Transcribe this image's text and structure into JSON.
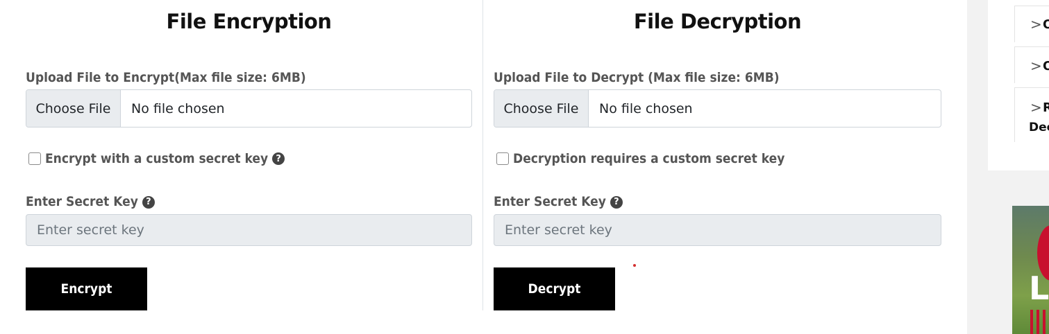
{
  "encrypt": {
    "title": "File Encryption",
    "upload_label": "Upload File to Encrypt(Max file size: 6MB)",
    "choose_file_label": "Choose File",
    "file_status": "No file chosen",
    "custom_key_checkbox_label": "Encrypt with a custom secret key",
    "custom_key_checked": false,
    "secret_key_label": "Enter Secret Key",
    "secret_key_value": "",
    "secret_key_placeholder": "Enter secret key",
    "action_label": "Encrypt"
  },
  "decrypt": {
    "title": "File Decryption",
    "upload_label": "Upload File to Decrypt (Max file size: 6MB)",
    "choose_file_label": "Choose File",
    "file_status": "No file chosen",
    "custom_key_checkbox_label": "Decryption requires a custom secret key",
    "custom_key_checked": false,
    "secret_key_label": "Enter Secret Key",
    "secret_key_value": "",
    "secret_key_placeholder": "Enter secret key",
    "action_label": "Decrypt"
  },
  "help_glyph": "?",
  "sidebar": {
    "items": [
      {
        "chevron": ">",
        "text": "O"
      },
      {
        "chevron": ">",
        "text": "O"
      },
      {
        "chevron": ">",
        "text": "R",
        "text2": "Dec"
      }
    ]
  },
  "ad": {
    "letter": "L"
  },
  "colors": {
    "button_bg": "#000000",
    "input_disabled_bg": "#e9ecef",
    "label_text": "#555555",
    "accent_dot": "#d32f2f"
  },
  "icons": {
    "help": "question-circle-icon",
    "chevron": "chevron-right-icon"
  }
}
